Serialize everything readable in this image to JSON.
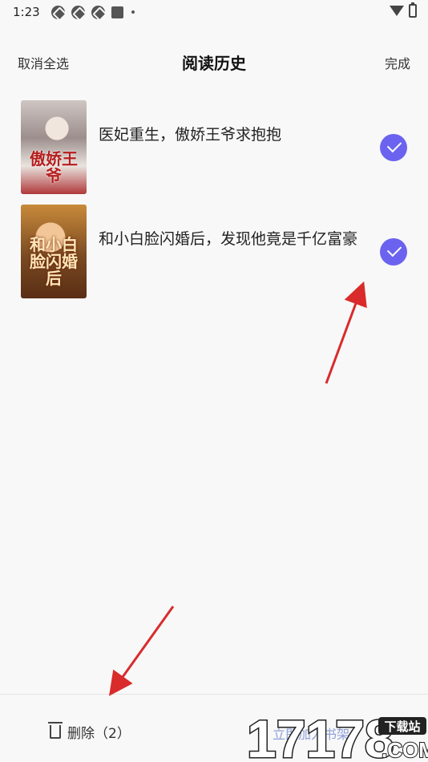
{
  "status_bar": {
    "time": "1:23"
  },
  "header": {
    "left_action": "取消全选",
    "title": "阅读历史",
    "right_action": "完成"
  },
  "books": [
    {
      "title": "医妃重生，傲娇王爷求抱抱",
      "cover_text": "傲娇王爷",
      "selected": true
    },
    {
      "title": "和小白脸闪婚后，发现他竟是千亿富豪",
      "cover_text": "和小白脸闪婚后",
      "selected": true
    }
  ],
  "bottom_bar": {
    "delete_label": "删除（2）",
    "right_label": "立即加入书架"
  },
  "colors": {
    "accent": "#6b63f0",
    "annotation_arrow": "#d92b2b"
  },
  "watermark": {
    "number": "17178",
    "tag": "下载站",
    "domain": ".COM"
  }
}
